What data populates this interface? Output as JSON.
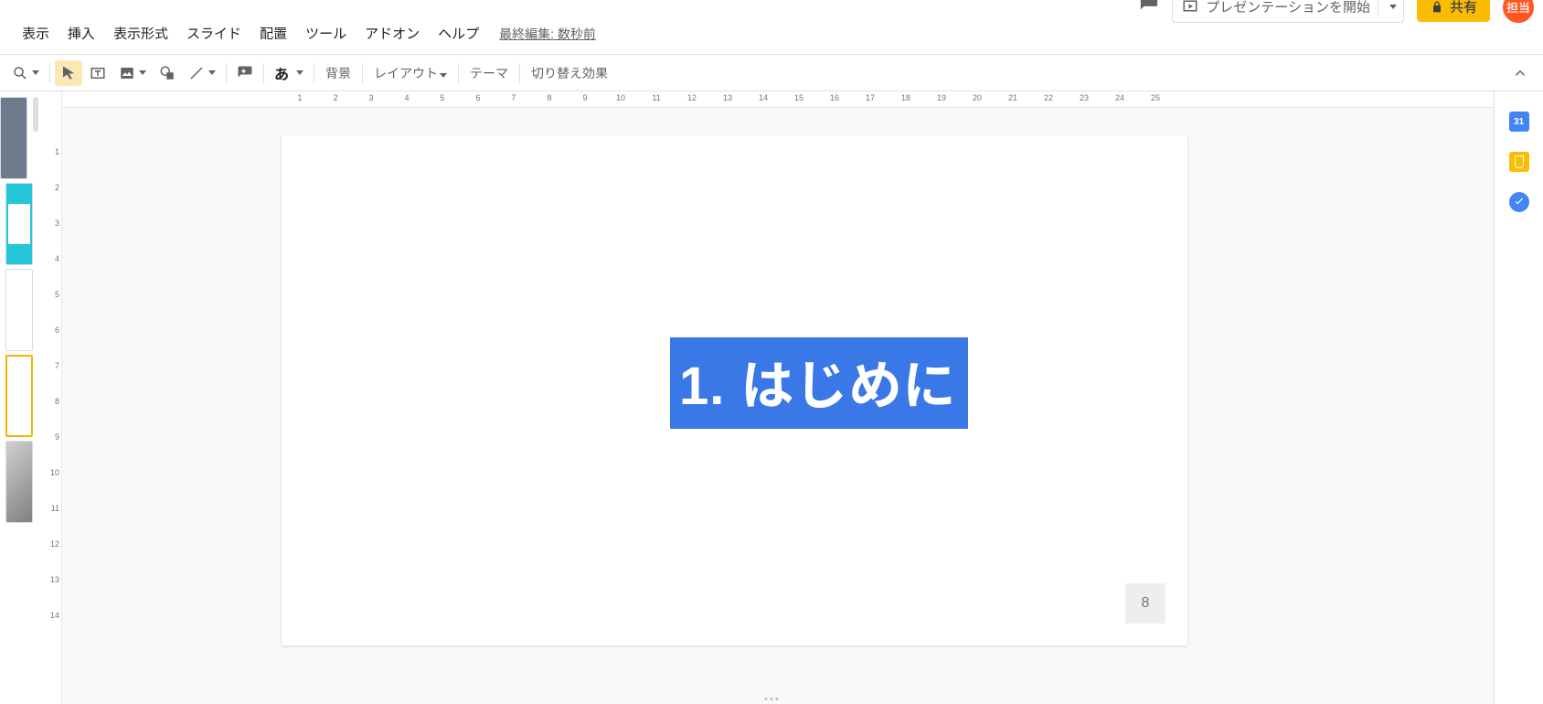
{
  "header": {
    "comment_icon": "comment",
    "present_label": "プレゼンテーションを開始",
    "share_label": "共有",
    "avatar_initial": "担当"
  },
  "menu": {
    "items": [
      "表示",
      "挿入",
      "表示形式",
      "スライド",
      "配置",
      "ツール",
      "アドオン",
      "ヘルプ"
    ],
    "last_edit": "最終編集: 数秒前"
  },
  "toolbar": {
    "zoom_icon": "zoom",
    "select_icon": "select",
    "textbox_icon": "text-box",
    "image_icon": "image",
    "shape_icon": "shape",
    "line_icon": "line",
    "comment_add_icon": "add-comment",
    "input_lang": "あ",
    "background": "背景",
    "layout": "レイアウト",
    "theme": "テーマ",
    "transition": "切り替え効果"
  },
  "ruler_h": [
    "1",
    "2",
    "3",
    "4",
    "5",
    "6",
    "7",
    "8",
    "9",
    "10",
    "11",
    "12",
    "13",
    "14",
    "15",
    "16",
    "17",
    "18",
    "19",
    "20",
    "21",
    "22",
    "23",
    "24",
    "25"
  ],
  "ruler_v": [
    "1",
    "2",
    "3",
    "4",
    "5",
    "6",
    "7",
    "8",
    "9",
    "10",
    "11",
    "12",
    "13",
    "14"
  ],
  "slide": {
    "title": "1. はじめに",
    "page_number": "8"
  },
  "sidepanel": {
    "calendar_day": "31"
  }
}
